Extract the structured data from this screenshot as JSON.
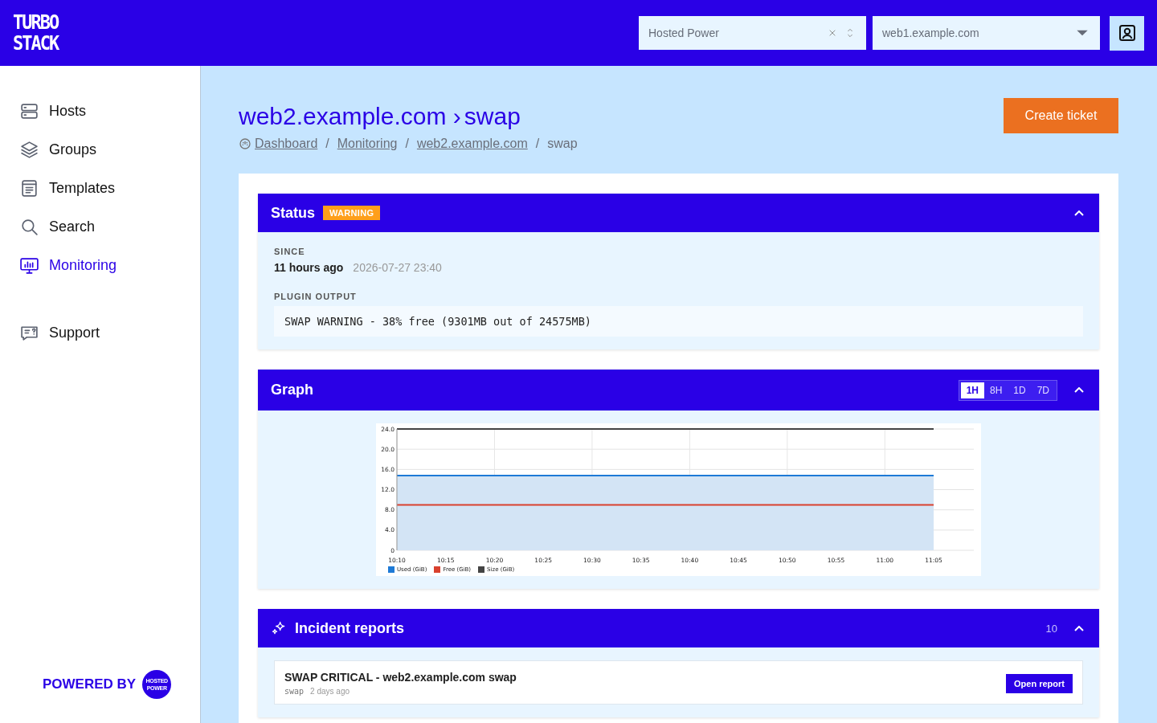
{
  "header": {
    "logo": [
      "TURBO",
      "STACK"
    ],
    "company_select": {
      "value": "Hosted Power"
    },
    "host_select": {
      "value": "web1.example.com"
    }
  },
  "sidebar": {
    "items": [
      {
        "label": "Hosts",
        "kind": "hosts",
        "selected": false
      },
      {
        "label": "Groups",
        "kind": "groups",
        "selected": false
      },
      {
        "label": "Templates",
        "kind": "templates",
        "selected": false
      },
      {
        "label": "Search",
        "kind": "search",
        "selected": false
      },
      {
        "label": "Monitoring",
        "kind": "monitoring",
        "selected": true
      }
    ],
    "bottom_items": [
      {
        "label": "Support",
        "kind": "support",
        "selected": false
      }
    ],
    "powered_by": "POWERED BY",
    "partner_logo": [
      "HOSTED",
      "POWER"
    ]
  },
  "page": {
    "title_host": "web2.example.com",
    "title_separator": "›",
    "title_check": "swap",
    "create_button": "Create ticket",
    "breadcrumb_separator": "/",
    "breadcrumbs": [
      {
        "label": "Dashboard",
        "link": true
      },
      {
        "label": "Monitoring",
        "link": true
      },
      {
        "label": "web2.example.com",
        "link": true
      },
      {
        "label": "swap",
        "link": false
      }
    ]
  },
  "status": {
    "title": "Status",
    "badge": "WARNING",
    "since_label": "SINCE",
    "since_relative": "11 hours ago",
    "since_date": "2026-07-27 23:40",
    "output_label": "PLUGIN OUTPUT",
    "output": "SWAP WARNING - 38% free (9301MB out of 24575MB)"
  },
  "graph": {
    "title": "Graph",
    "ranges": [
      {
        "label": "1H",
        "selected": true
      },
      {
        "label": "8H",
        "selected": false
      },
      {
        "label": "1D",
        "selected": false
      },
      {
        "label": "7D",
        "selected": false
      }
    ],
    "chart_data": {
      "type": "line",
      "grid": true,
      "legend": "bottom-left",
      "x": [
        "10:10",
        "10:15",
        "10:20",
        "10:25",
        "10:30",
        "10:35",
        "10:40",
        "10:45",
        "10:50",
        "10:55",
        "11:00",
        "11:05"
      ],
      "ylim": [
        0,
        24
      ],
      "yticks": [
        {
          "value": 0,
          "label": "0"
        },
        {
          "value": 4,
          "label": "4.0"
        },
        {
          "value": 8,
          "label": "8.0"
        },
        {
          "value": 12,
          "label": "12.0"
        },
        {
          "value": 16,
          "label": "16.0"
        },
        {
          "value": 20,
          "label": "20.0"
        },
        {
          "value": 24,
          "label": "24.0"
        }
      ],
      "series": [
        {
          "name": "Used (GiB)",
          "color": "#1e7ad6",
          "values": [
            14.8,
            14.8,
            14.8,
            14.8,
            14.8,
            14.8,
            14.8,
            14.8,
            14.8,
            14.8,
            14.8,
            14.8
          ]
        },
        {
          "name": "Free (GiB)",
          "color": "#d9412e",
          "values": [
            9.0,
            9.0,
            9.0,
            9.0,
            9.0,
            9.0,
            9.0,
            9.0,
            9.0,
            9.0,
            9.0,
            9.0
          ]
        },
        {
          "name": "Size (GiB)",
          "color": "#444444",
          "values": [
            24.0,
            24.0,
            24.0,
            24.0,
            24.0,
            24.0,
            24.0,
            24.0,
            24.0,
            24.0,
            24.0,
            24.0
          ]
        }
      ]
    }
  },
  "incidents": {
    "title": "Incident reports",
    "count": "10",
    "items": [
      {
        "title": "SWAP CRITICAL - web2.example.com swap",
        "check": "swap",
        "time": "2 days ago",
        "button": "Open report"
      }
    ]
  }
}
